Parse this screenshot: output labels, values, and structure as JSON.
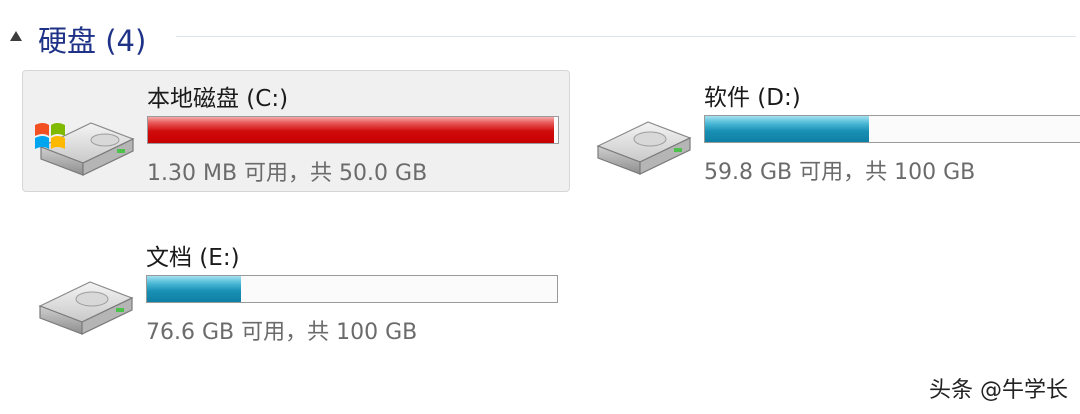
{
  "group": {
    "title": "硬盘 (4)"
  },
  "drives": [
    {
      "name": "本地磁盘 (C:)",
      "free_text": "1.30 MB 可用，共 50.0 GB",
      "used_fraction": 0.99,
      "bar_color": "#c80000",
      "icon": "windows-system-drive-icon",
      "selected": true
    },
    {
      "name": "软件 (D:)",
      "free_text": "59.8 GB 可用，共 100 GB",
      "used_fraction": 0.4,
      "bar_color": "#1990b5",
      "icon": "hard-drive-icon",
      "selected": false
    },
    {
      "name": "文档 (E:)",
      "free_text": "76.6 GB 可用，共 100 GB",
      "used_fraction": 0.23,
      "bar_color": "#1990b5",
      "icon": "hard-drive-icon",
      "selected": false
    }
  ],
  "watermark": "头条 @牛学长"
}
